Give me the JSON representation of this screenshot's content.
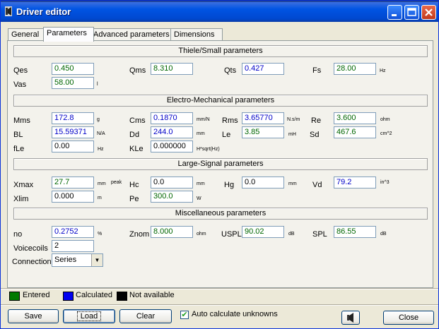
{
  "window": {
    "title": "Driver editor"
  },
  "tabs": [
    "General",
    "Parameters",
    "Advanced parameters",
    "Dimensions"
  ],
  "sections": {
    "thiele": "Thiele/Small parameters",
    "em": "Electro-Mechanical parameters",
    "ls": "Large-Signal parameters",
    "misc": "Miscellaneous parameters"
  },
  "params": {
    "qes": {
      "label": "Qes",
      "value": "0.450",
      "unit": ""
    },
    "qms": {
      "label": "Qms",
      "value": "8.310",
      "unit": ""
    },
    "qts": {
      "label": "Qts",
      "value": "0.427",
      "unit": ""
    },
    "fs": {
      "label": "Fs",
      "value": "28.00",
      "unit": "Hz"
    },
    "vas": {
      "label": "Vas",
      "value": "58.00",
      "unit": "l"
    },
    "mms": {
      "label": "Mms",
      "value": "172.8",
      "unit": "g"
    },
    "cms": {
      "label": "Cms",
      "value": "0.1870",
      "unit": "mm/N"
    },
    "rms": {
      "label": "Rms",
      "value": "3.65770",
      "unit": "N.s/m"
    },
    "re": {
      "label": "Re",
      "value": "3.600",
      "unit": "ohm"
    },
    "bl": {
      "label": "BL",
      "value": "15.59371",
      "unit": "N/A"
    },
    "dd": {
      "label": "Dd",
      "value": "244.0",
      "unit": "mm"
    },
    "le": {
      "label": "Le",
      "value": "3.85",
      "unit": "mH"
    },
    "sd": {
      "label": "Sd",
      "value": "467.6",
      "unit": "cm^2"
    },
    "fle": {
      "label": "fLe",
      "value": "0.00",
      "unit": "Hz"
    },
    "kle": {
      "label": "KLe",
      "value": "0.000000",
      "unit": "H*sqrt(Hz)"
    },
    "xmax": {
      "label": "Xmax",
      "value": "27.7",
      "unit": "mm",
      "extra": "peak"
    },
    "hc": {
      "label": "Hc",
      "value": "0.0",
      "unit": "mm"
    },
    "hg": {
      "label": "Hg",
      "value": "0.0",
      "unit": "mm"
    },
    "vd": {
      "label": "Vd",
      "value": "79.2",
      "unit": "in^3"
    },
    "xlim": {
      "label": "Xlim",
      "value": "0.000",
      "unit": "m"
    },
    "pe": {
      "label": "Pe",
      "value": "300.0",
      "unit": "W"
    },
    "no": {
      "label": "no",
      "value": "0.2752",
      "unit": "%"
    },
    "znom": {
      "label": "Znom",
      "value": "8.000",
      "unit": "ohm"
    },
    "uspl": {
      "label": "USPL",
      "value": "90.02",
      "unit": "dB"
    },
    "spl": {
      "label": "SPL",
      "value": "86.55",
      "unit": "dB"
    },
    "voicecoils": {
      "label": "Voicecoils",
      "value": "2"
    },
    "connection": {
      "label": "Connection",
      "value": "Series"
    }
  },
  "legend": [
    {
      "label": "Entered",
      "color": "#007A00"
    },
    {
      "label": "Calculated",
      "color": "#0000F0"
    },
    {
      "label": "Not available",
      "color": "#000000"
    }
  ],
  "buttons": {
    "save": "Save",
    "load": "Load",
    "clear": "Clear",
    "close": "Close"
  },
  "auto_calc": {
    "label": "Auto calculate unknowns",
    "checked": true
  }
}
